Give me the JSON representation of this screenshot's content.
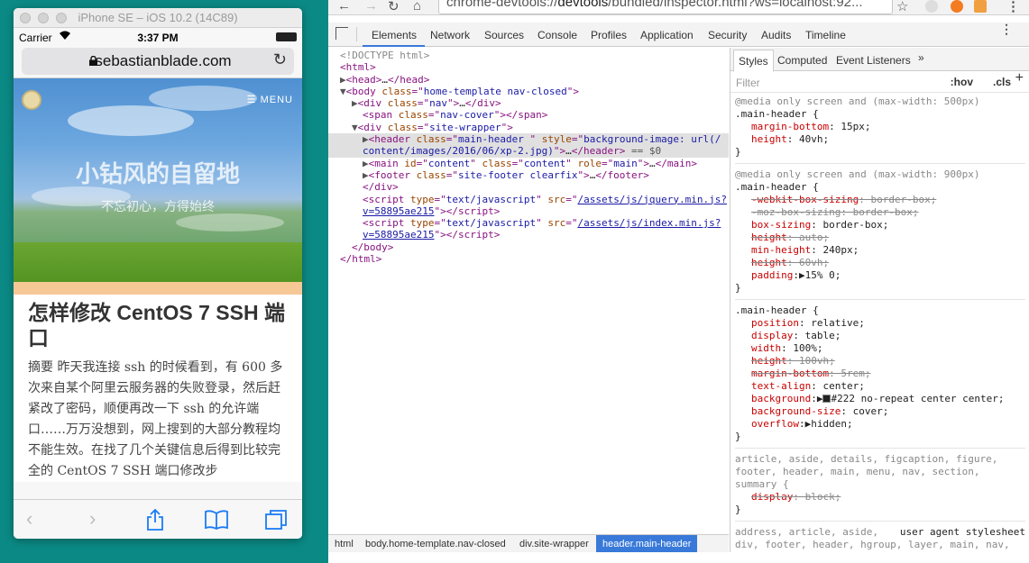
{
  "simulator": {
    "title": "iPhone SE – iOS 10.2 (14C89)",
    "carrier": "Carrier",
    "wifi_icon": "wifi-icon",
    "time": "3:37 PM",
    "url": "sebastianblade.com",
    "hero": {
      "menu_label": "MENU",
      "title": "小钻风的自留地",
      "subtitle": "不忘初心，方得始终"
    },
    "post": {
      "title": "怎样修改 CentOS 7 SSH 端口",
      "body": "摘要 昨天我连接 ssh 的时候看到，有 600 多次来自某个阿里云服务器的失败登录，然后赶紧改了密码，顺便再改一下 ssh 的允许端口……万万没想到，网上搜到的大部分教程均不能生效。在找了几个关键信息后得到比较完全的 CentOS 7 SSH 端口修改步"
    },
    "toolbar_icons": [
      "back-icon",
      "forward-icon",
      "share-icon",
      "bookmarks-icon",
      "tabs-icon"
    ]
  },
  "chrome": {
    "url_scheme": "chrome-devtools://",
    "url_host": "devtools",
    "url_path": "/bundled/inspector.html?ws=localhost:92..."
  },
  "devtools": {
    "tabs": [
      "Elements",
      "Network",
      "Sources",
      "Console",
      "Profiles",
      "Application",
      "Security",
      "Audits",
      "Timeline"
    ],
    "breadcrumbs": [
      "html",
      "body.home-template.nav-closed",
      "div.site-wrapper",
      "header.main-header"
    ],
    "styles_tabs": [
      "Styles",
      "Computed",
      "Event Listeners"
    ],
    "filter_placeholder": "Filter",
    "hov": ":hov",
    "cls": ".cls",
    "dom": {
      "doctype": "<!DOCTYPE html>",
      "main_header_style": "background-image: url(/content/images/2016/06/xp-2.jpg)",
      "script1_src": "/assets/js/jquery.min.js?v=58895ae215",
      "script2_src": "/assets/js/index.min.js?v=58895ae215",
      "selected_marker": "== $0"
    },
    "css": {
      "media1": "@media only screen and (max-width: 500px)",
      "media2": "@media only screen and (max-width: 900px)",
      "selector": ".main-header {",
      "ua_selector_1": "article, aside, details, figcaption, figure, footer, header, main, menu, nav, section, summary {",
      "ua_label": "user agent stylesheet",
      "ua_selector_2": "address, article, aside, div, footer, header, hgroup, layer, main, nav, section {"
    }
  }
}
